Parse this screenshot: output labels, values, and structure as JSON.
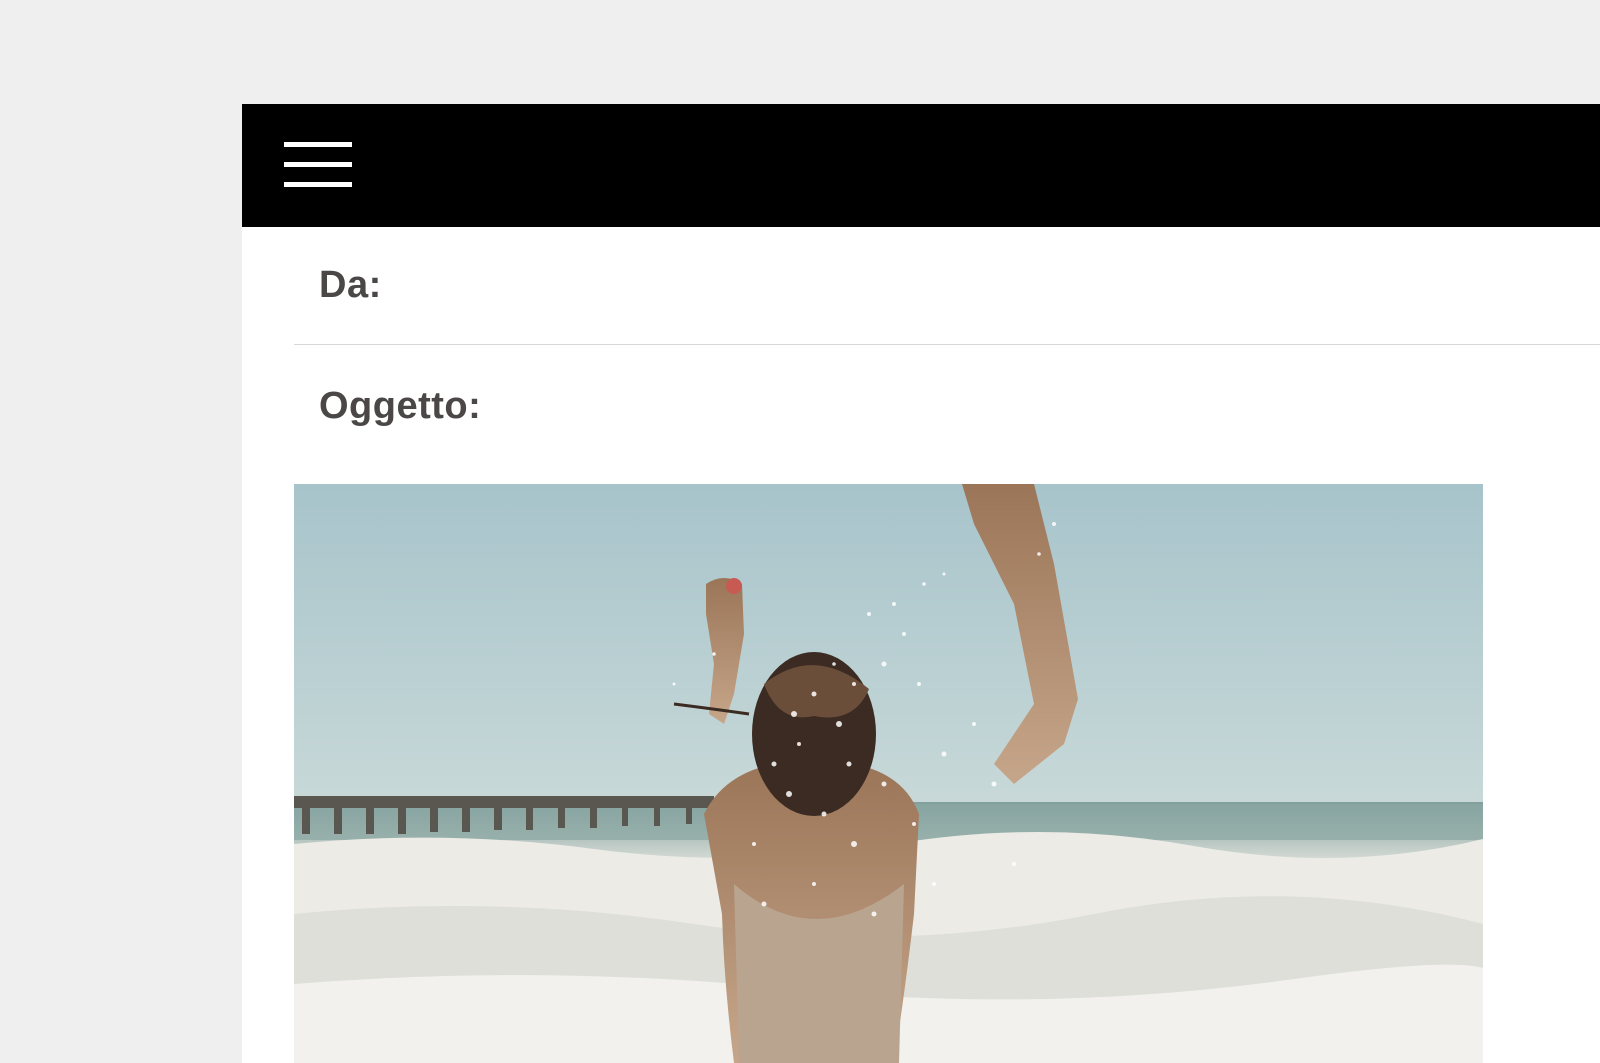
{
  "header": {
    "menu_icon": "hamburger-menu-icon"
  },
  "email": {
    "from_label": "Da:",
    "subject_label": "Oggetto:"
  },
  "image": {
    "description_icon": "beach-photo"
  },
  "colors": {
    "top_bar": "#000000",
    "background": "#efefef",
    "label_text": "#4a4746",
    "sky": "#a9c6cc",
    "sea_foam": "#e6e6e0"
  }
}
